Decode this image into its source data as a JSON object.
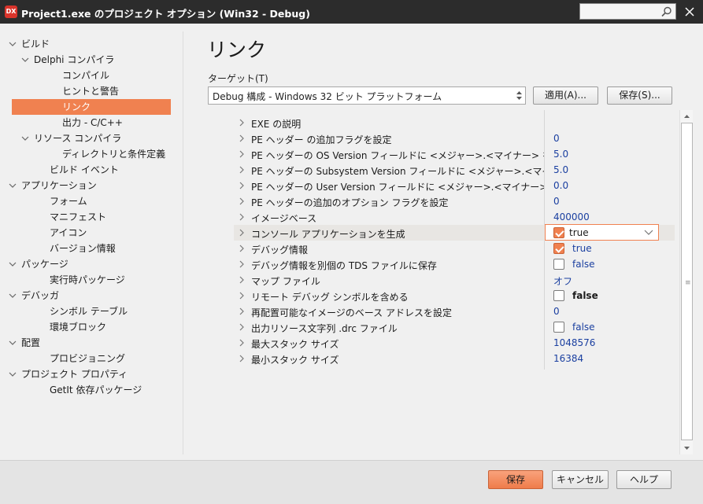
{
  "window": {
    "title": "Project1.exe のプロジェクト オプション (Win32 - Debug)",
    "app_icon_text": "DX",
    "search_placeholder": "",
    "close_label": "×"
  },
  "nav": {
    "items": [
      {
        "label": "ビルド",
        "expanded": true,
        "selected": false
      },
      {
        "label": "Delphi コンパイラ",
        "expanded": true,
        "selected": false
      },
      {
        "label": "コンパイル",
        "selected": false
      },
      {
        "label": "ヒントと警告",
        "selected": false
      },
      {
        "label": "リンク",
        "selected": true
      },
      {
        "label": "出力 - C/C++",
        "selected": false
      },
      {
        "label": "リソース コンパイラ",
        "expanded": true,
        "selected": false
      },
      {
        "label": "ディレクトリと条件定義",
        "selected": false
      },
      {
        "label": "ビルド イベント",
        "selected": false
      },
      {
        "label": "アプリケーション",
        "expanded": true,
        "selected": false
      },
      {
        "label": "フォーム",
        "selected": false
      },
      {
        "label": "マニフェスト",
        "selected": false
      },
      {
        "label": "アイコン",
        "selected": false
      },
      {
        "label": "バージョン情報",
        "selected": false
      },
      {
        "label": "パッケージ",
        "expanded": true,
        "selected": false
      },
      {
        "label": "実行時パッケージ",
        "selected": false
      },
      {
        "label": "デバッガ",
        "expanded": true,
        "selected": false
      },
      {
        "label": "シンボル テーブル",
        "selected": false
      },
      {
        "label": "環境ブロック",
        "selected": false
      },
      {
        "label": "配置",
        "expanded": true,
        "selected": false
      },
      {
        "label": "プロビジョニング",
        "selected": false
      },
      {
        "label": "プロジェクト プロパティ",
        "expanded": true,
        "selected": false
      },
      {
        "label": "GetIt 依存パッケージ",
        "selected": false
      }
    ]
  },
  "main": {
    "page_title": "リンク",
    "target_label": "ターゲット(T)",
    "target_value": "Debug 構成 - Windows 32 ビット プラットフォーム",
    "apply_button": "適用(A)...",
    "save_as_button": "保存(S)..."
  },
  "properties": [
    {
      "name": "EXE の説明",
      "value": "",
      "kind": "text"
    },
    {
      "name": "PE ヘッダー の追加フラグを設定",
      "value": "0",
      "kind": "text"
    },
    {
      "name": "PE ヘッダーの OS Version フィールドに <メジャー>.<マイナー> を設定",
      "value": "5.0",
      "kind": "text"
    },
    {
      "name": "PE ヘッダーの Subsystem Version フィールドに <メジャー>.<マイナー> を設定",
      "value": "5.0",
      "kind": "text"
    },
    {
      "name": "PE ヘッダーの User Version フィールドに <メジャー>.<マイナー> を設定",
      "value": "0.0",
      "kind": "text"
    },
    {
      "name": "PE ヘッダーの追加のオプション フラグを設定",
      "value": "0",
      "kind": "text"
    },
    {
      "name": "イメージベース",
      "value": "400000",
      "kind": "text"
    },
    {
      "name": "コンソール アプリケーションを生成",
      "value": "true",
      "kind": "checkbox-edit",
      "checked": true
    },
    {
      "name": "デバッグ情報",
      "value": "true",
      "kind": "checkbox",
      "checked": true
    },
    {
      "name": "デバッグ情報を別個の TDS ファイルに保存",
      "value": "false",
      "kind": "checkbox",
      "checked": false
    },
    {
      "name": "マップ ファイル",
      "value": "オフ",
      "kind": "text"
    },
    {
      "name": "リモート デバッグ シンボルを含める",
      "value": "false",
      "kind": "checkbox-bold",
      "checked": false
    },
    {
      "name": "再配置可能なイメージのベース アドレスを設定",
      "value": "0",
      "kind": "text"
    },
    {
      "name": "出力リソース文字列 .drc ファイル",
      "value": "false",
      "kind": "checkbox",
      "checked": false
    },
    {
      "name": "最大スタック サイズ",
      "value": "1048576",
      "kind": "text"
    },
    {
      "name": "最小スタック サイズ",
      "value": "16384",
      "kind": "text"
    }
  ],
  "footer": {
    "save_button": "保存",
    "cancel_button": "キャンセル",
    "help_button": "ヘルプ"
  },
  "colors": {
    "accent": "#f08150",
    "titlebar": "#2c2c2c",
    "value_blue": "#1a3fa0"
  }
}
